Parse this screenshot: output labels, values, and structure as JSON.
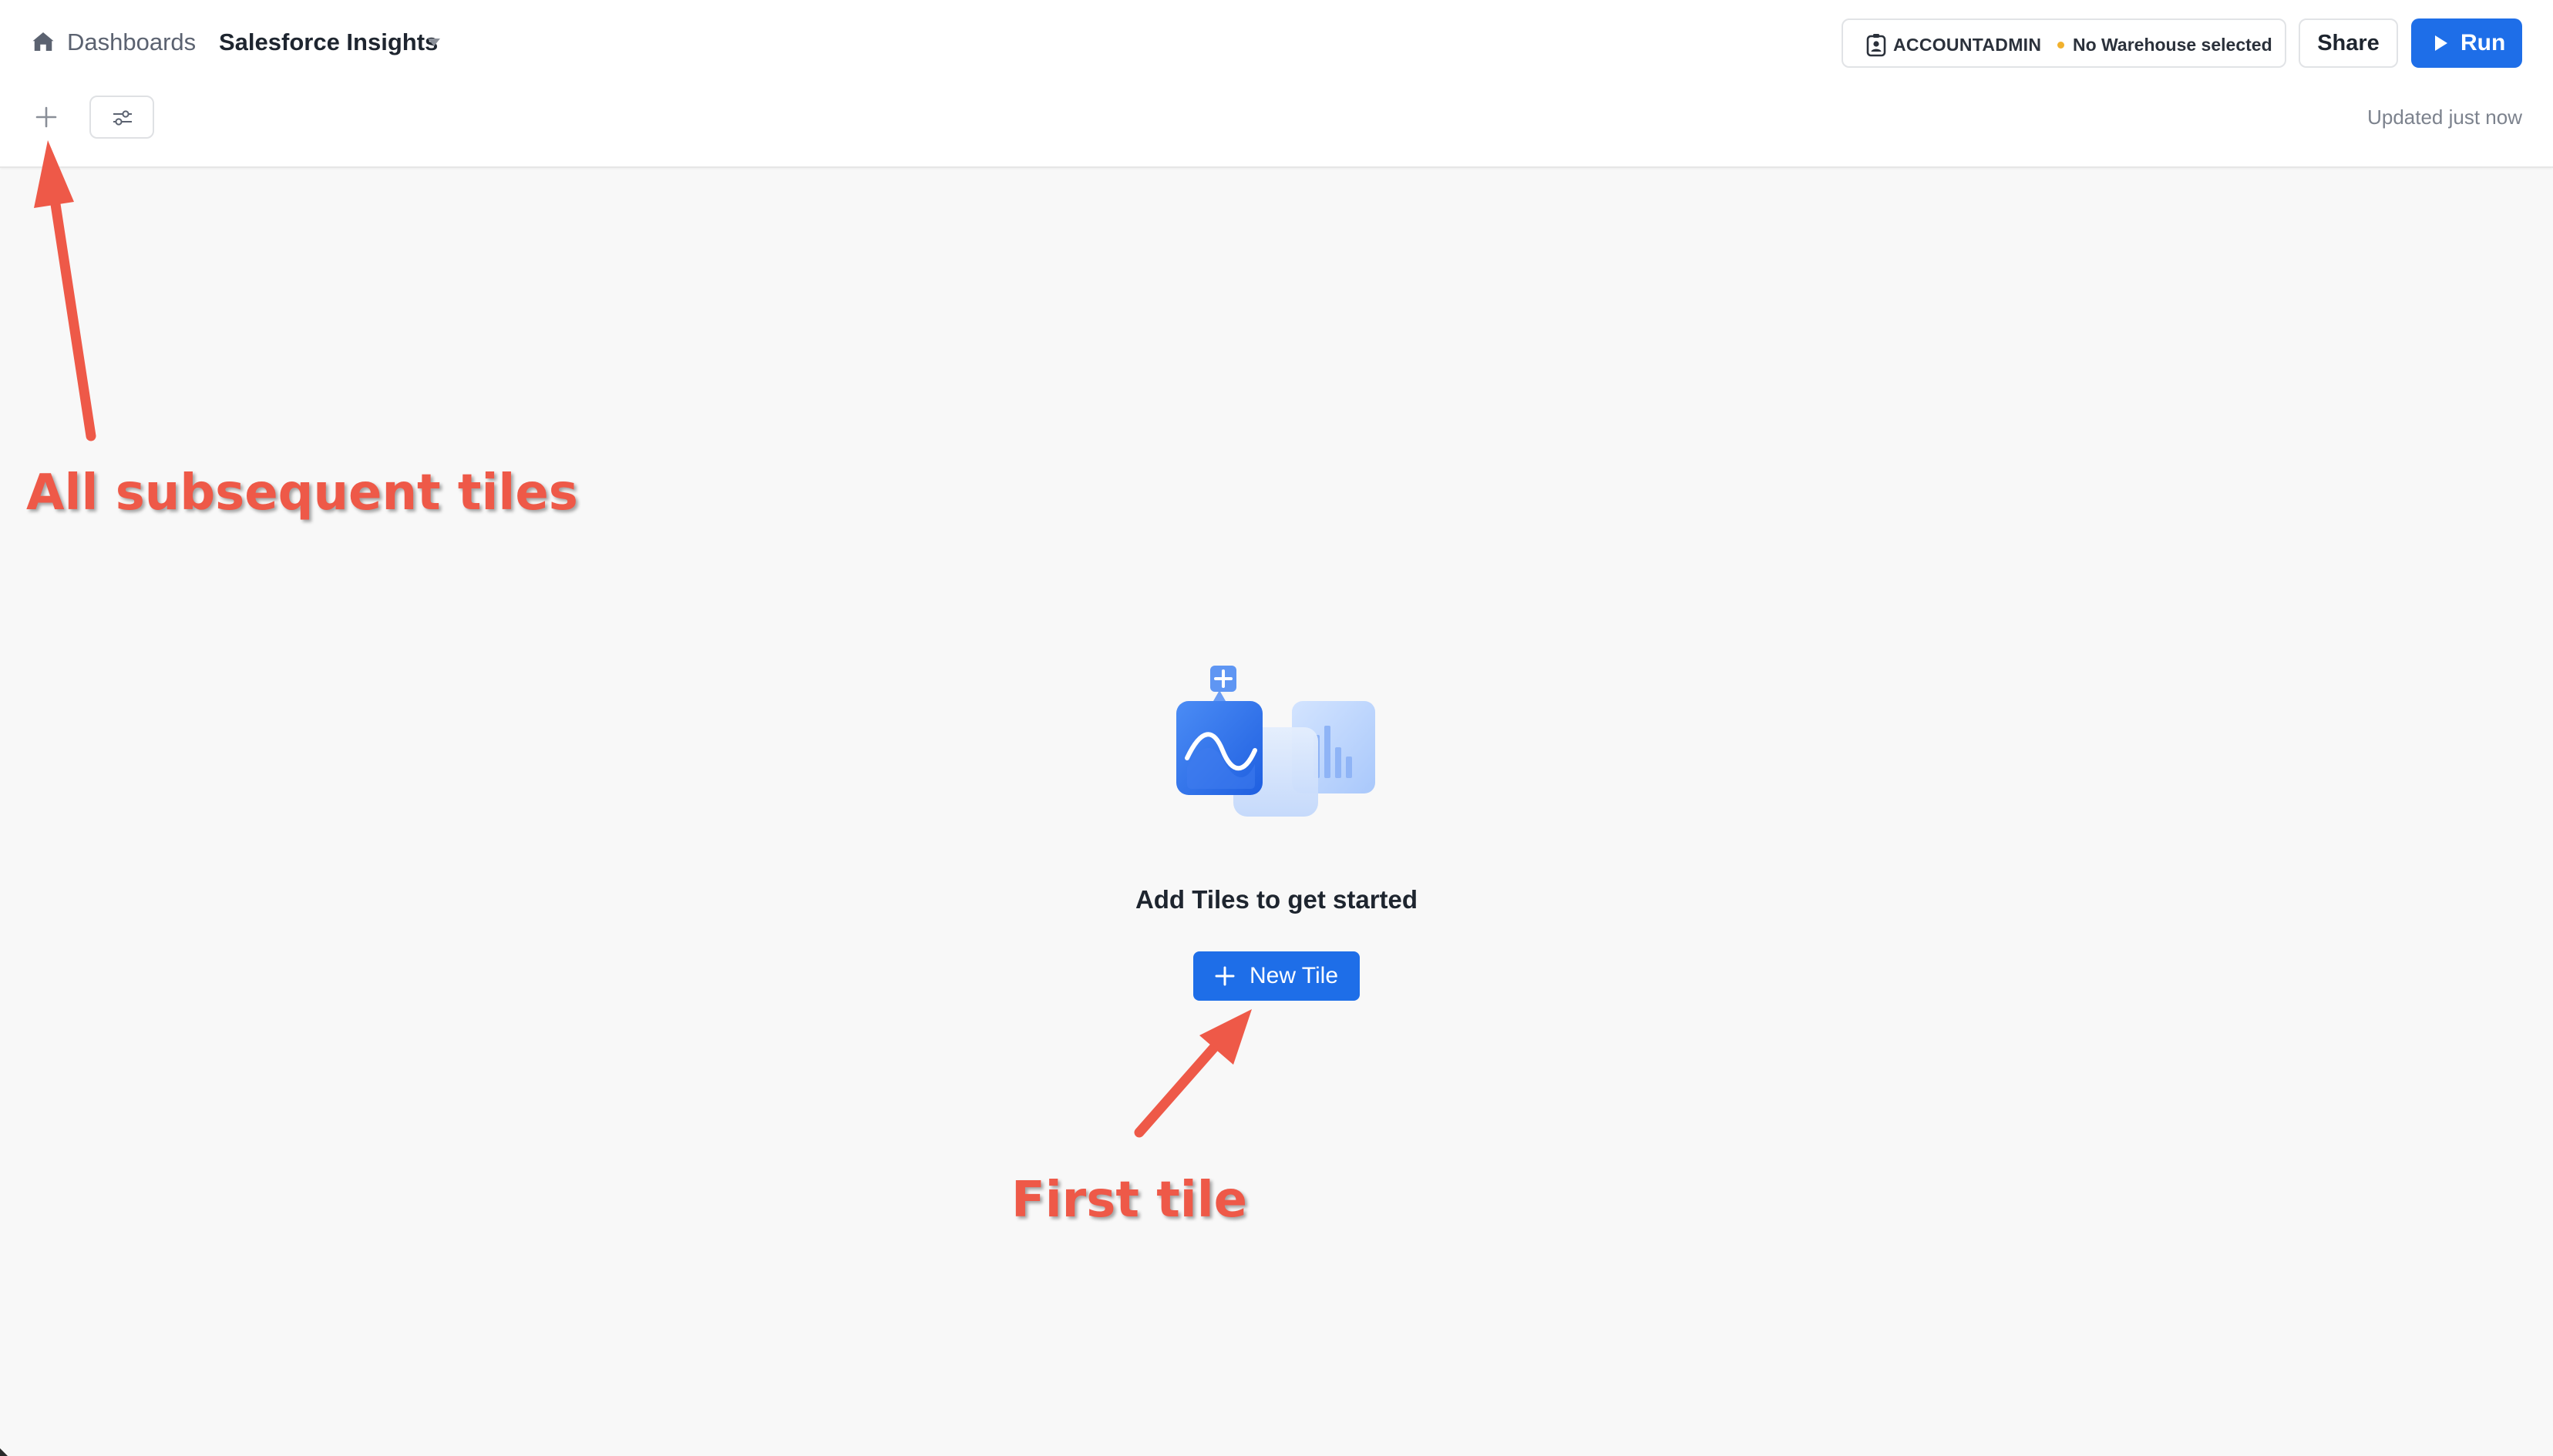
{
  "header": {
    "breadcrumb": "Dashboards",
    "dashboard_title": "Salesforce Insights",
    "role": "ACCOUNTADMIN",
    "warehouse": "No Warehouse selected",
    "share_label": "Share",
    "run_label": "Run",
    "updated_text": "Updated just now"
  },
  "empty_state": {
    "title": "Add Tiles to get started",
    "button_label": "New Tile"
  },
  "annotations": {
    "left_label": "All subsequent tiles",
    "center_label": "First tile",
    "color": "#ee5948"
  },
  "colors": {
    "accent": "#1e6ee8",
    "warehouse_dot": "#f1b12d"
  },
  "icons": [
    "home-icon",
    "chevron-down-icon",
    "user-badge-icon",
    "play-icon",
    "plus-icon",
    "filter-sliders-icon",
    "tiles-illustration"
  ]
}
